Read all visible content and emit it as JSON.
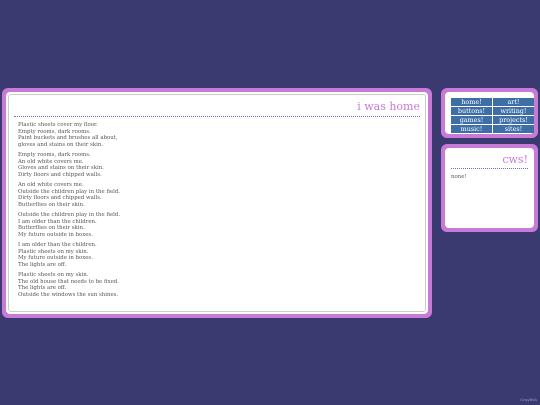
{
  "main": {
    "title": "i was home",
    "stanzas": [
      [
        "Plastic sheets cover my floor.",
        "Empty rooms, dark rooms.",
        "Paint buckets and brushes all about,",
        "gloves and stains on their skin."
      ],
      [
        "Empty rooms, dark rooms.",
        "An old white covers me.",
        "Gloves and stains on their skin.",
        "Dirty floors and chipped walls."
      ],
      [
        "An old white covers me.",
        "Outside the children play in the field.",
        "Dirty floors and chipped walls.",
        "Butterflies on their skin."
      ],
      [
        "Outside the children play in the field.",
        "I am older than the children.",
        "Butterflies on their skin.",
        "My future outside in boxes."
      ],
      [
        "I am older than the children.",
        "Plastic sheets on my skin.",
        "My future outside in boxes.",
        "The lights are off."
      ],
      [
        "Plastic sheets on my skin.",
        "The old house that needs to be fixed.",
        "The lights are off.",
        "Outside the windows the sun shines."
      ]
    ]
  },
  "nav": {
    "items": [
      "home!",
      "art!",
      "buttons!",
      "writing!",
      "games!",
      "projects!",
      "music!",
      "sites!"
    ]
  },
  "news": {
    "title": "cws!",
    "body": "none!"
  },
  "credit": "Crayfish",
  "colors": {
    "background": "#3a3a70",
    "panel_border": "#c77ad6",
    "nav_button": "#3d6ea6",
    "heading": "#c77ad6"
  }
}
